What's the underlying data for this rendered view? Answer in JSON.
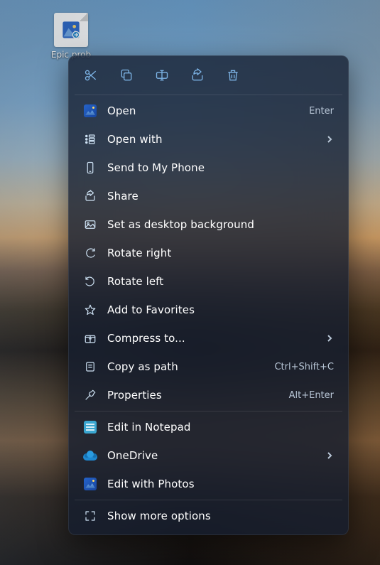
{
  "desktop": {
    "file_label": "Epic prob"
  },
  "toolbar": {
    "cut": "Cut",
    "copy": "Copy",
    "rename": "Rename",
    "share": "Share",
    "delete": "Delete"
  },
  "menu": {
    "open": {
      "label": "Open",
      "accel": "Enter"
    },
    "open_with": {
      "label": "Open with",
      "submenu": true
    },
    "send_to_phone": {
      "label": "Send to My Phone"
    },
    "share": {
      "label": "Share"
    },
    "set_bg": {
      "label": "Set as desktop background"
    },
    "rotate_right": {
      "label": "Rotate right"
    },
    "rotate_left": {
      "label": "Rotate left"
    },
    "add_favorites": {
      "label": "Add to Favorites"
    },
    "compress": {
      "label": "Compress to...",
      "submenu": true
    },
    "copy_path": {
      "label": "Copy as path",
      "accel": "Ctrl+Shift+C"
    },
    "properties": {
      "label": "Properties",
      "accel": "Alt+Enter"
    },
    "edit_notepad": {
      "label": "Edit in Notepad"
    },
    "onedrive": {
      "label": "OneDrive",
      "submenu": true
    },
    "edit_photos": {
      "label": "Edit with Photos"
    },
    "more": {
      "label": "Show more options"
    }
  }
}
